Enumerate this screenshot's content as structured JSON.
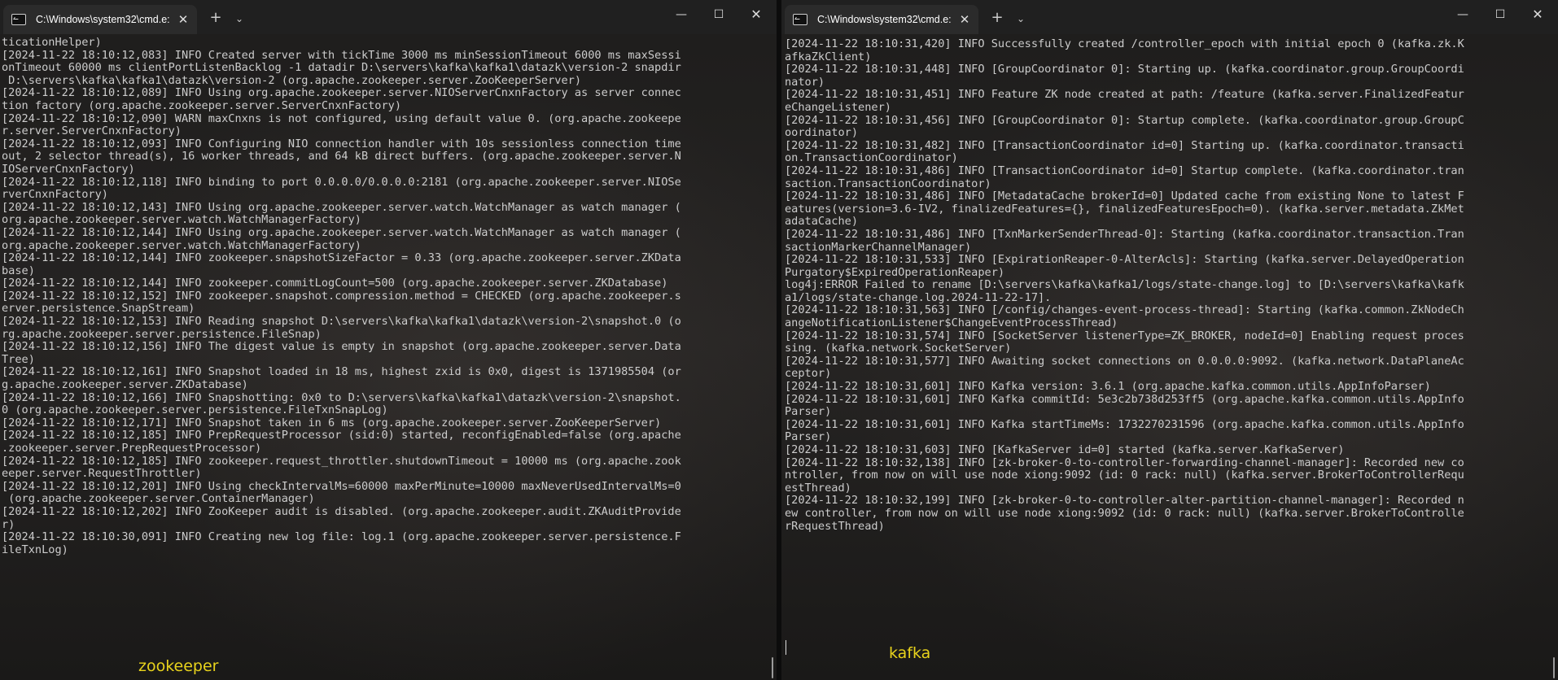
{
  "left": {
    "tab_title": "C:\\Windows\\system32\\cmd.e:",
    "label": "zookeeper",
    "lines": [
      "ticationHelper)",
      "[2024-11-22 18:10:12,083] INFO Created server with tickTime 3000 ms minSessionTimeout 6000 ms maxSessi",
      "onTimeout 60000 ms clientPortListenBacklog -1 datadir D:\\servers\\kafka\\kafka1\\datazk\\version-2 snapdir",
      " D:\\servers\\kafka\\kafka1\\datazk\\version-2 (org.apache.zookeeper.server.ZooKeeperServer)",
      "[2024-11-22 18:10:12,089] INFO Using org.apache.zookeeper.server.NIOServerCnxnFactory as server connec",
      "tion factory (org.apache.zookeeper.server.ServerCnxnFactory)",
      "[2024-11-22 18:10:12,090] WARN maxCnxns is not configured, using default value 0. (org.apache.zookeepe",
      "r.server.ServerCnxnFactory)",
      "[2024-11-22 18:10:12,093] INFO Configuring NIO connection handler with 10s sessionless connection time",
      "out, 2 selector thread(s), 16 worker threads, and 64 kB direct buffers. (org.apache.zookeeper.server.N",
      "IOServerCnxnFactory)",
      "[2024-11-22 18:10:12,118] INFO binding to port 0.0.0.0/0.0.0.0:2181 (org.apache.zookeeper.server.NIOSe",
      "rverCnxnFactory)",
      "[2024-11-22 18:10:12,143] INFO Using org.apache.zookeeper.server.watch.WatchManager as watch manager (",
      "org.apache.zookeeper.server.watch.WatchManagerFactory)",
      "[2024-11-22 18:10:12,144] INFO Using org.apache.zookeeper.server.watch.WatchManager as watch manager (",
      "org.apache.zookeeper.server.watch.WatchManagerFactory)",
      "[2024-11-22 18:10:12,144] INFO zookeeper.snapshotSizeFactor = 0.33 (org.apache.zookeeper.server.ZKData",
      "base)",
      "[2024-11-22 18:10:12,144] INFO zookeeper.commitLogCount=500 (org.apache.zookeeper.server.ZKDatabase)",
      "[2024-11-22 18:10:12,152] INFO zookeeper.snapshot.compression.method = CHECKED (org.apache.zookeeper.s",
      "erver.persistence.SnapStream)",
      "[2024-11-22 18:10:12,153] INFO Reading snapshot D:\\servers\\kafka\\kafka1\\datazk\\version-2\\snapshot.0 (o",
      "rg.apache.zookeeper.server.persistence.FileSnap)",
      "[2024-11-22 18:10:12,156] INFO The digest value is empty in snapshot (org.apache.zookeeper.server.Data",
      "Tree)",
      "[2024-11-22 18:10:12,161] INFO Snapshot loaded in 18 ms, highest zxid is 0x0, digest is 1371985504 (or",
      "g.apache.zookeeper.server.ZKDatabase)",
      "[2024-11-22 18:10:12,166] INFO Snapshotting: 0x0 to D:\\servers\\kafka\\kafka1\\datazk\\version-2\\snapshot.",
      "0 (org.apache.zookeeper.server.persistence.FileTxnSnapLog)",
      "[2024-11-22 18:10:12,171] INFO Snapshot taken in 6 ms (org.apache.zookeeper.server.ZooKeeperServer)",
      "[2024-11-22 18:10:12,185] INFO PrepRequestProcessor (sid:0) started, reconfigEnabled=false (org.apache",
      ".zookeeper.server.PrepRequestProcessor)",
      "[2024-11-22 18:10:12,185] INFO zookeeper.request_throttler.shutdownTimeout = 10000 ms (org.apache.zook",
      "eeper.server.RequestThrottler)",
      "[2024-11-22 18:10:12,201] INFO Using checkIntervalMs=60000 maxPerMinute=10000 maxNeverUsedIntervalMs=0",
      " (org.apache.zookeeper.server.ContainerManager)",
      "[2024-11-22 18:10:12,202] INFO ZooKeeper audit is disabled. (org.apache.zookeeper.audit.ZKAuditProvide",
      "r)",
      "[2024-11-22 18:10:30,091] INFO Creating new log file: log.1 (org.apache.zookeeper.server.persistence.F",
      "ileTxnLog)"
    ]
  },
  "right": {
    "tab_title": "C:\\Windows\\system32\\cmd.e:",
    "label": "kafka",
    "lines": [
      "[2024-11-22 18:10:31,420] INFO Successfully created /controller_epoch with initial epoch 0 (kafka.zk.K",
      "afkaZkClient)",
      "[2024-11-22 18:10:31,448] INFO [GroupCoordinator 0]: Starting up. (kafka.coordinator.group.GroupCoordi",
      "nator)",
      "[2024-11-22 18:10:31,451] INFO Feature ZK node created at path: /feature (kafka.server.FinalizedFeatur",
      "eChangeListener)",
      "[2024-11-22 18:10:31,456] INFO [GroupCoordinator 0]: Startup complete. (kafka.coordinator.group.GroupC",
      "oordinator)",
      "[2024-11-22 18:10:31,482] INFO [TransactionCoordinator id=0] Starting up. (kafka.coordinator.transacti",
      "on.TransactionCoordinator)",
      "[2024-11-22 18:10:31,486] INFO [TransactionCoordinator id=0] Startup complete. (kafka.coordinator.tran",
      "saction.TransactionCoordinator)",
      "[2024-11-22 18:10:31,486] INFO [MetadataCache brokerId=0] Updated cache from existing None to latest F",
      "eatures(version=3.6-IV2, finalizedFeatures={}, finalizedFeaturesEpoch=0). (kafka.server.metadata.ZkMet",
      "adataCache)",
      "[2024-11-22 18:10:31,486] INFO [TxnMarkerSenderThread-0]: Starting (kafka.coordinator.transaction.Tran",
      "sactionMarkerChannelManager)",
      "[2024-11-22 18:10:31,533] INFO [ExpirationReaper-0-AlterAcls]: Starting (kafka.server.DelayedOperation",
      "Purgatory$ExpiredOperationReaper)",
      "log4j:ERROR Failed to rename [D:\\servers\\kafka\\kafka1/logs/state-change.log] to [D:\\servers\\kafka\\kafk",
      "a1/logs/state-change.log.2024-11-22-17].",
      "[2024-11-22 18:10:31,563] INFO [/config/changes-event-process-thread]: Starting (kafka.common.ZkNodeCh",
      "angeNotificationListener$ChangeEventProcessThread)",
      "[2024-11-22 18:10:31,574] INFO [SocketServer listenerType=ZK_BROKER, nodeId=0] Enabling request proces",
      "sing. (kafka.network.SocketServer)",
      "[2024-11-22 18:10:31,577] INFO Awaiting socket connections on 0.0.0.0:9092. (kafka.network.DataPlaneAc",
      "ceptor)",
      "[2024-11-22 18:10:31,601] INFO Kafka version: 3.6.1 (org.apache.kafka.common.utils.AppInfoParser)",
      "[2024-11-22 18:10:31,601] INFO Kafka commitId: 5e3c2b738d253ff5 (org.apache.kafka.common.utils.AppInfo",
      "Parser)",
      "[2024-11-22 18:10:31,601] INFO Kafka startTimeMs: 1732270231596 (org.apache.kafka.common.utils.AppInfo",
      "Parser)",
      "[2024-11-22 18:10:31,603] INFO [KafkaServer id=0] started (kafka.server.KafkaServer)",
      "[2024-11-22 18:10:32,138] INFO [zk-broker-0-to-controller-forwarding-channel-manager]: Recorded new co",
      "ntroller, from now on will use node xiong:9092 (id: 0 rack: null) (kafka.server.BrokerToControllerRequ",
      "estThread)",
      "[2024-11-22 18:10:32,199] INFO [zk-broker-0-to-controller-alter-partition-channel-manager]: Recorded n",
      "ew controller, from now on will use node xiong:9092 (id: 0 rack: null) (kafka.server.BrokerToControlle",
      "rRequestThread)"
    ]
  },
  "icons": {
    "new_tab": "+",
    "dropdown": "⌄",
    "minimize": "—",
    "maximize": "☐",
    "close": "✕",
    "tab_close": "✕"
  },
  "colors": {
    "text": "#cccccc",
    "label": "#e8d31c",
    "background": "#1e1d1c"
  }
}
